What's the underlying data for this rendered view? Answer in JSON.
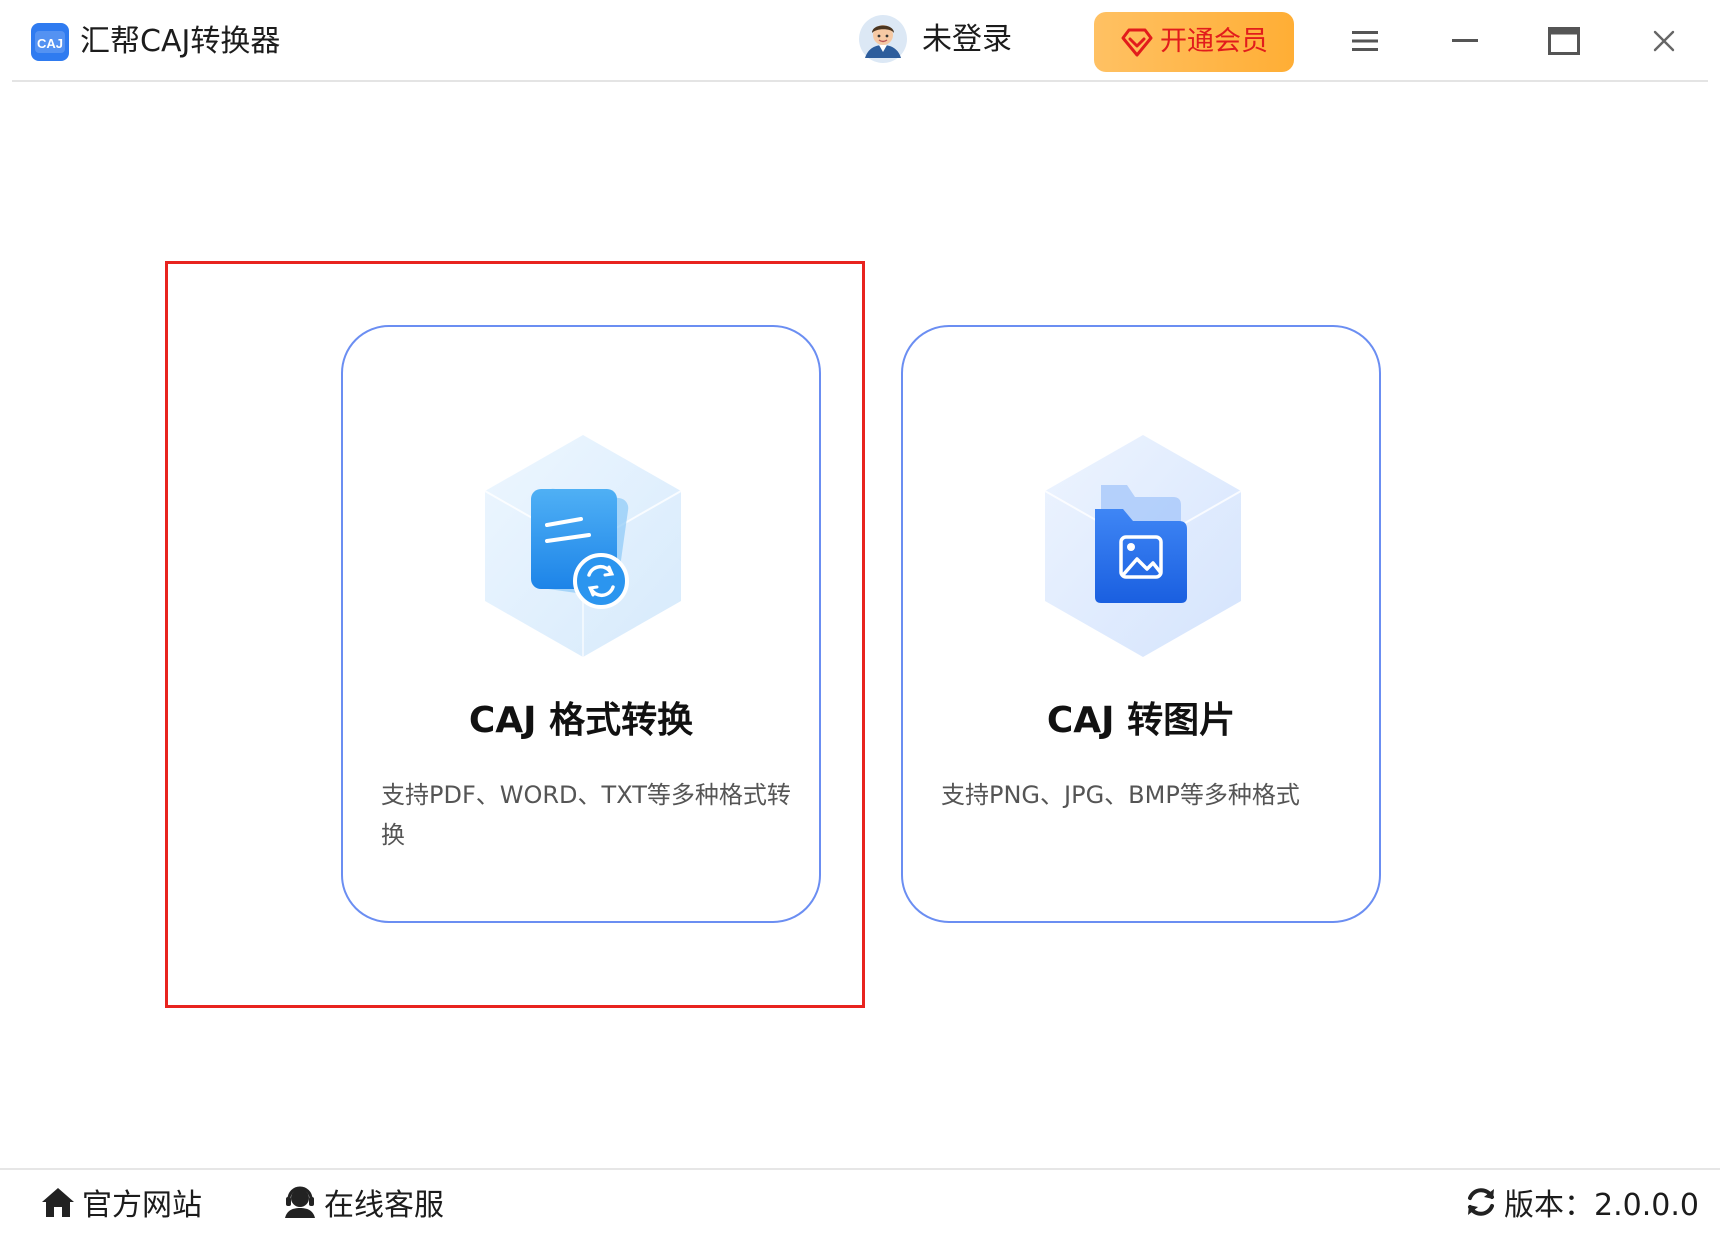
{
  "titlebar": {
    "app_title": "汇帮CAJ转换器",
    "logo_text": "CAJ",
    "login_status": "未登录",
    "vip_button": "开通会员",
    "icons": {
      "logo": "caj-logo-icon",
      "avatar": "user-avatar-icon",
      "vip": "diamond-icon",
      "menu": "hamburger-menu-icon",
      "minimize": "minimize-icon",
      "maximize": "maximize-icon",
      "close": "close-icon"
    }
  },
  "cards": [
    {
      "title": "CAJ 格式转换",
      "description": "支持PDF、WORD、TXT等多种格式转换",
      "icon": "document-convert-icon"
    },
    {
      "title": "CAJ 转图片",
      "description": "支持PNG、JPG、BMP等多种格式",
      "icon": "image-folder-icon"
    }
  ],
  "footer": {
    "website": "官方网站",
    "service": "在线客服",
    "version": "版本：2.0.0.0",
    "icons": {
      "website": "home-icon",
      "service": "customer-service-icon",
      "version": "refresh-icon"
    }
  },
  "colors": {
    "accent_blue": "#6b8ef2",
    "vip_gradient_start": "#ffc163",
    "vip_gradient_end": "#ffae35",
    "vip_text": "#e21c1c",
    "highlight_red": "#e8231f"
  }
}
